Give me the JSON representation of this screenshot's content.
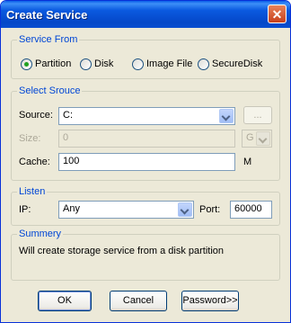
{
  "window": {
    "title": "Create Service",
    "close_symbol": "✕"
  },
  "service_from": {
    "legend": "Service From",
    "options": [
      {
        "label": "Partition",
        "checked": true
      },
      {
        "label": "Disk",
        "checked": false
      },
      {
        "label": "Image File",
        "checked": false
      },
      {
        "label": "SecureDisk",
        "checked": false
      }
    ]
  },
  "select_source": {
    "legend": "Select Srouce",
    "source_label": "Source:",
    "source_value": "C:",
    "browse_label": "...",
    "size_label": "Size:",
    "size_value": "0",
    "size_unit": "G",
    "cache_label": "Cache:",
    "cache_value": "100",
    "cache_unit": "M"
  },
  "listen": {
    "legend": "Listen",
    "ip_label": "IP:",
    "ip_value": "Any",
    "port_label": "Port:",
    "port_value": "60000"
  },
  "summery": {
    "legend": "Summery",
    "text": "Will create storage service from a disk partition"
  },
  "buttons": {
    "ok": "OK",
    "cancel": "Cancel",
    "password": "Password>>"
  }
}
